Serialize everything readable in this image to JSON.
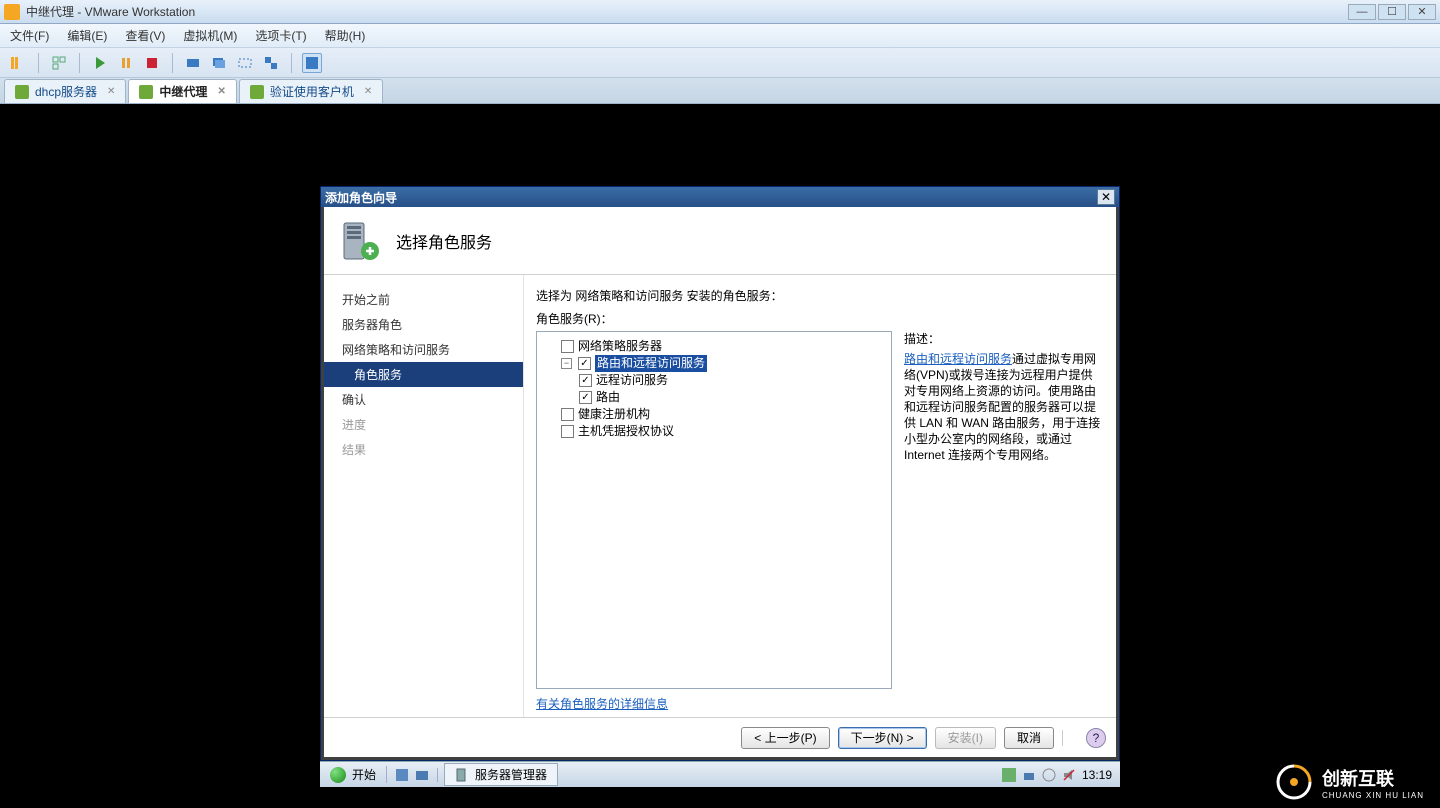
{
  "vmware": {
    "title": "中继代理 - VMware Workstation",
    "menu": {
      "file": "文件(F)",
      "edit": "编辑(E)",
      "view": "查看(V)",
      "vm": "虚拟机(M)",
      "tabs": "选项卡(T)",
      "help": "帮助(H)"
    },
    "tabs": [
      {
        "label": "dhcp服务器",
        "active": false
      },
      {
        "label": "中继代理",
        "active": true
      },
      {
        "label": "验证使用客户机",
        "active": false
      }
    ]
  },
  "wizard": {
    "window_title": "添加角色向导",
    "header_title": "选择角色服务",
    "nav": {
      "before": "开始之前",
      "roles": "服务器角色",
      "npas": "网络策略和访问服务",
      "role_svc": "角色服务",
      "confirm": "确认",
      "progress": "进度",
      "results": "结果"
    },
    "instruction": "选择为 网络策略和访问服务 安装的角色服务：",
    "tree_label": "角色服务(R)：",
    "tree": {
      "nps": "网络策略服务器",
      "rras": "路由和远程访问服务",
      "ras": "远程访问服务",
      "routing": "路由",
      "hra": "健康注册机构",
      "hcap": "主机凭据授权协议"
    },
    "description": {
      "heading": "描述：",
      "link": "路由和远程访问服务",
      "body": "通过虚拟专用网络(VPN)或拨号连接为远程用户提供对专用网络上资源的访问。使用路由和远程访问服务配置的服务器可以提供 LAN 和 WAN 路由服务，用于连接小型办公室内的网络段，或通过 Internet 连接两个专用网络。"
    },
    "more_link": "有关角色服务的详细信息",
    "buttons": {
      "back": "< 上一步(P)",
      "next": "下一步(N) >",
      "install": "安装(I)",
      "cancel": "取消"
    }
  },
  "taskbar": {
    "start": "开始",
    "task": "服务器管理器",
    "time": "13:19"
  },
  "brand": {
    "name": "创新互联",
    "sub": "CHUANG XIN HU LIAN"
  }
}
